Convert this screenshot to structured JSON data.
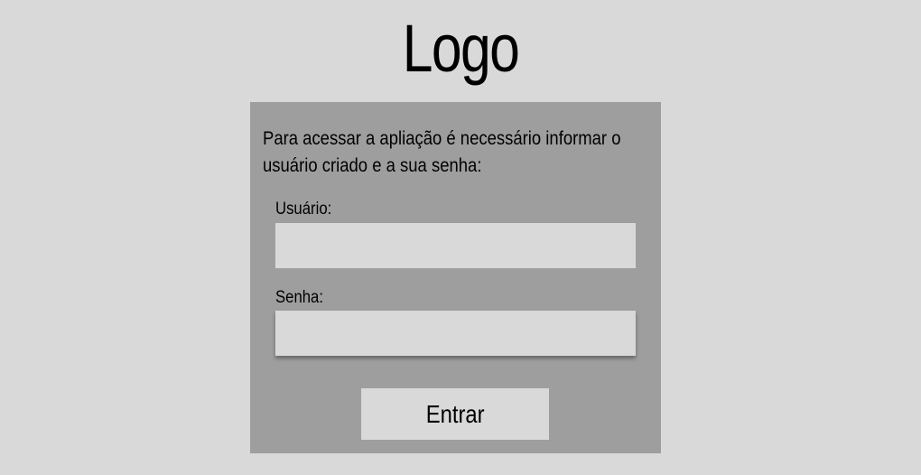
{
  "header": {
    "logo_text": "Logo"
  },
  "login": {
    "intro_text": "Para acessar a apliação é necessário informar o usuário criado e a sua senha:",
    "username_label": "Usuário:",
    "username_value": "",
    "password_label": "Senha:",
    "password_value": "",
    "submit_label": "Entrar"
  },
  "colors": {
    "background": "#d9d9d9",
    "panel": "#9e9e9e",
    "field": "#d9d9d9",
    "text": "#000000"
  }
}
